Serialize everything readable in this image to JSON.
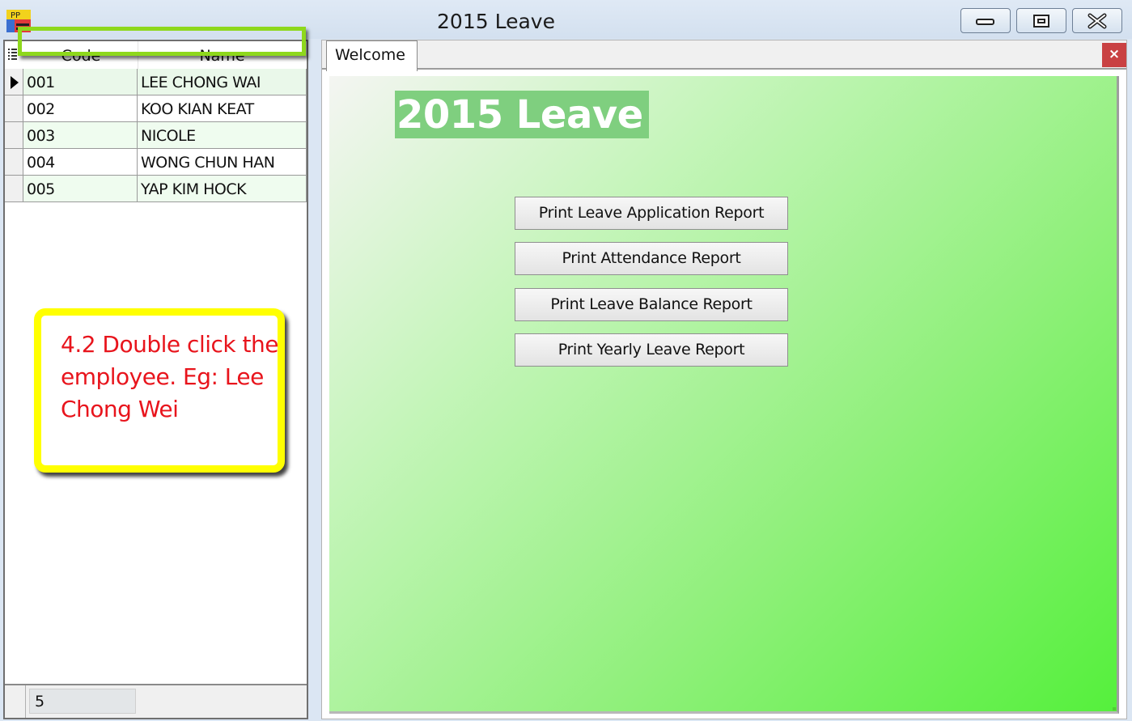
{
  "window": {
    "title": "2015 Leave",
    "controls": {
      "minimize": "minimize",
      "maximize": "maximize",
      "close": "close"
    }
  },
  "employee_grid": {
    "columns": [
      "Code",
      "Name"
    ],
    "rows": [
      {
        "code": "001",
        "name": "LEE CHONG WAI",
        "current": true
      },
      {
        "code": "002",
        "name": "KOO KIAN KEAT",
        "current": false
      },
      {
        "code": "003",
        "name": "NICOLE",
        "current": false
      },
      {
        "code": "004",
        "name": "WONG CHUN HAN",
        "current": false
      },
      {
        "code": "005",
        "name": "YAP KIM HOCK",
        "current": false
      }
    ],
    "footer_count": "5"
  },
  "callout": {
    "text": "4.2 Double click the employee. Eg: Lee Chong Wei",
    "border_color": "#ffff00",
    "text_color": "#e8141c"
  },
  "tabs": [
    {
      "label": "Welcome",
      "active": true
    }
  ],
  "tab_close_label": "×",
  "welcome": {
    "banner": "2015 Leave",
    "buttons": [
      "Print Leave Application Report",
      "Print Attendance Report",
      "Print Leave Balance Report",
      "Print Yearly Leave Report"
    ]
  },
  "colors": {
    "highlight_box": "#8ed81c",
    "banner_bg": "#7fcf7f",
    "tab_close_bg": "#c94142"
  }
}
